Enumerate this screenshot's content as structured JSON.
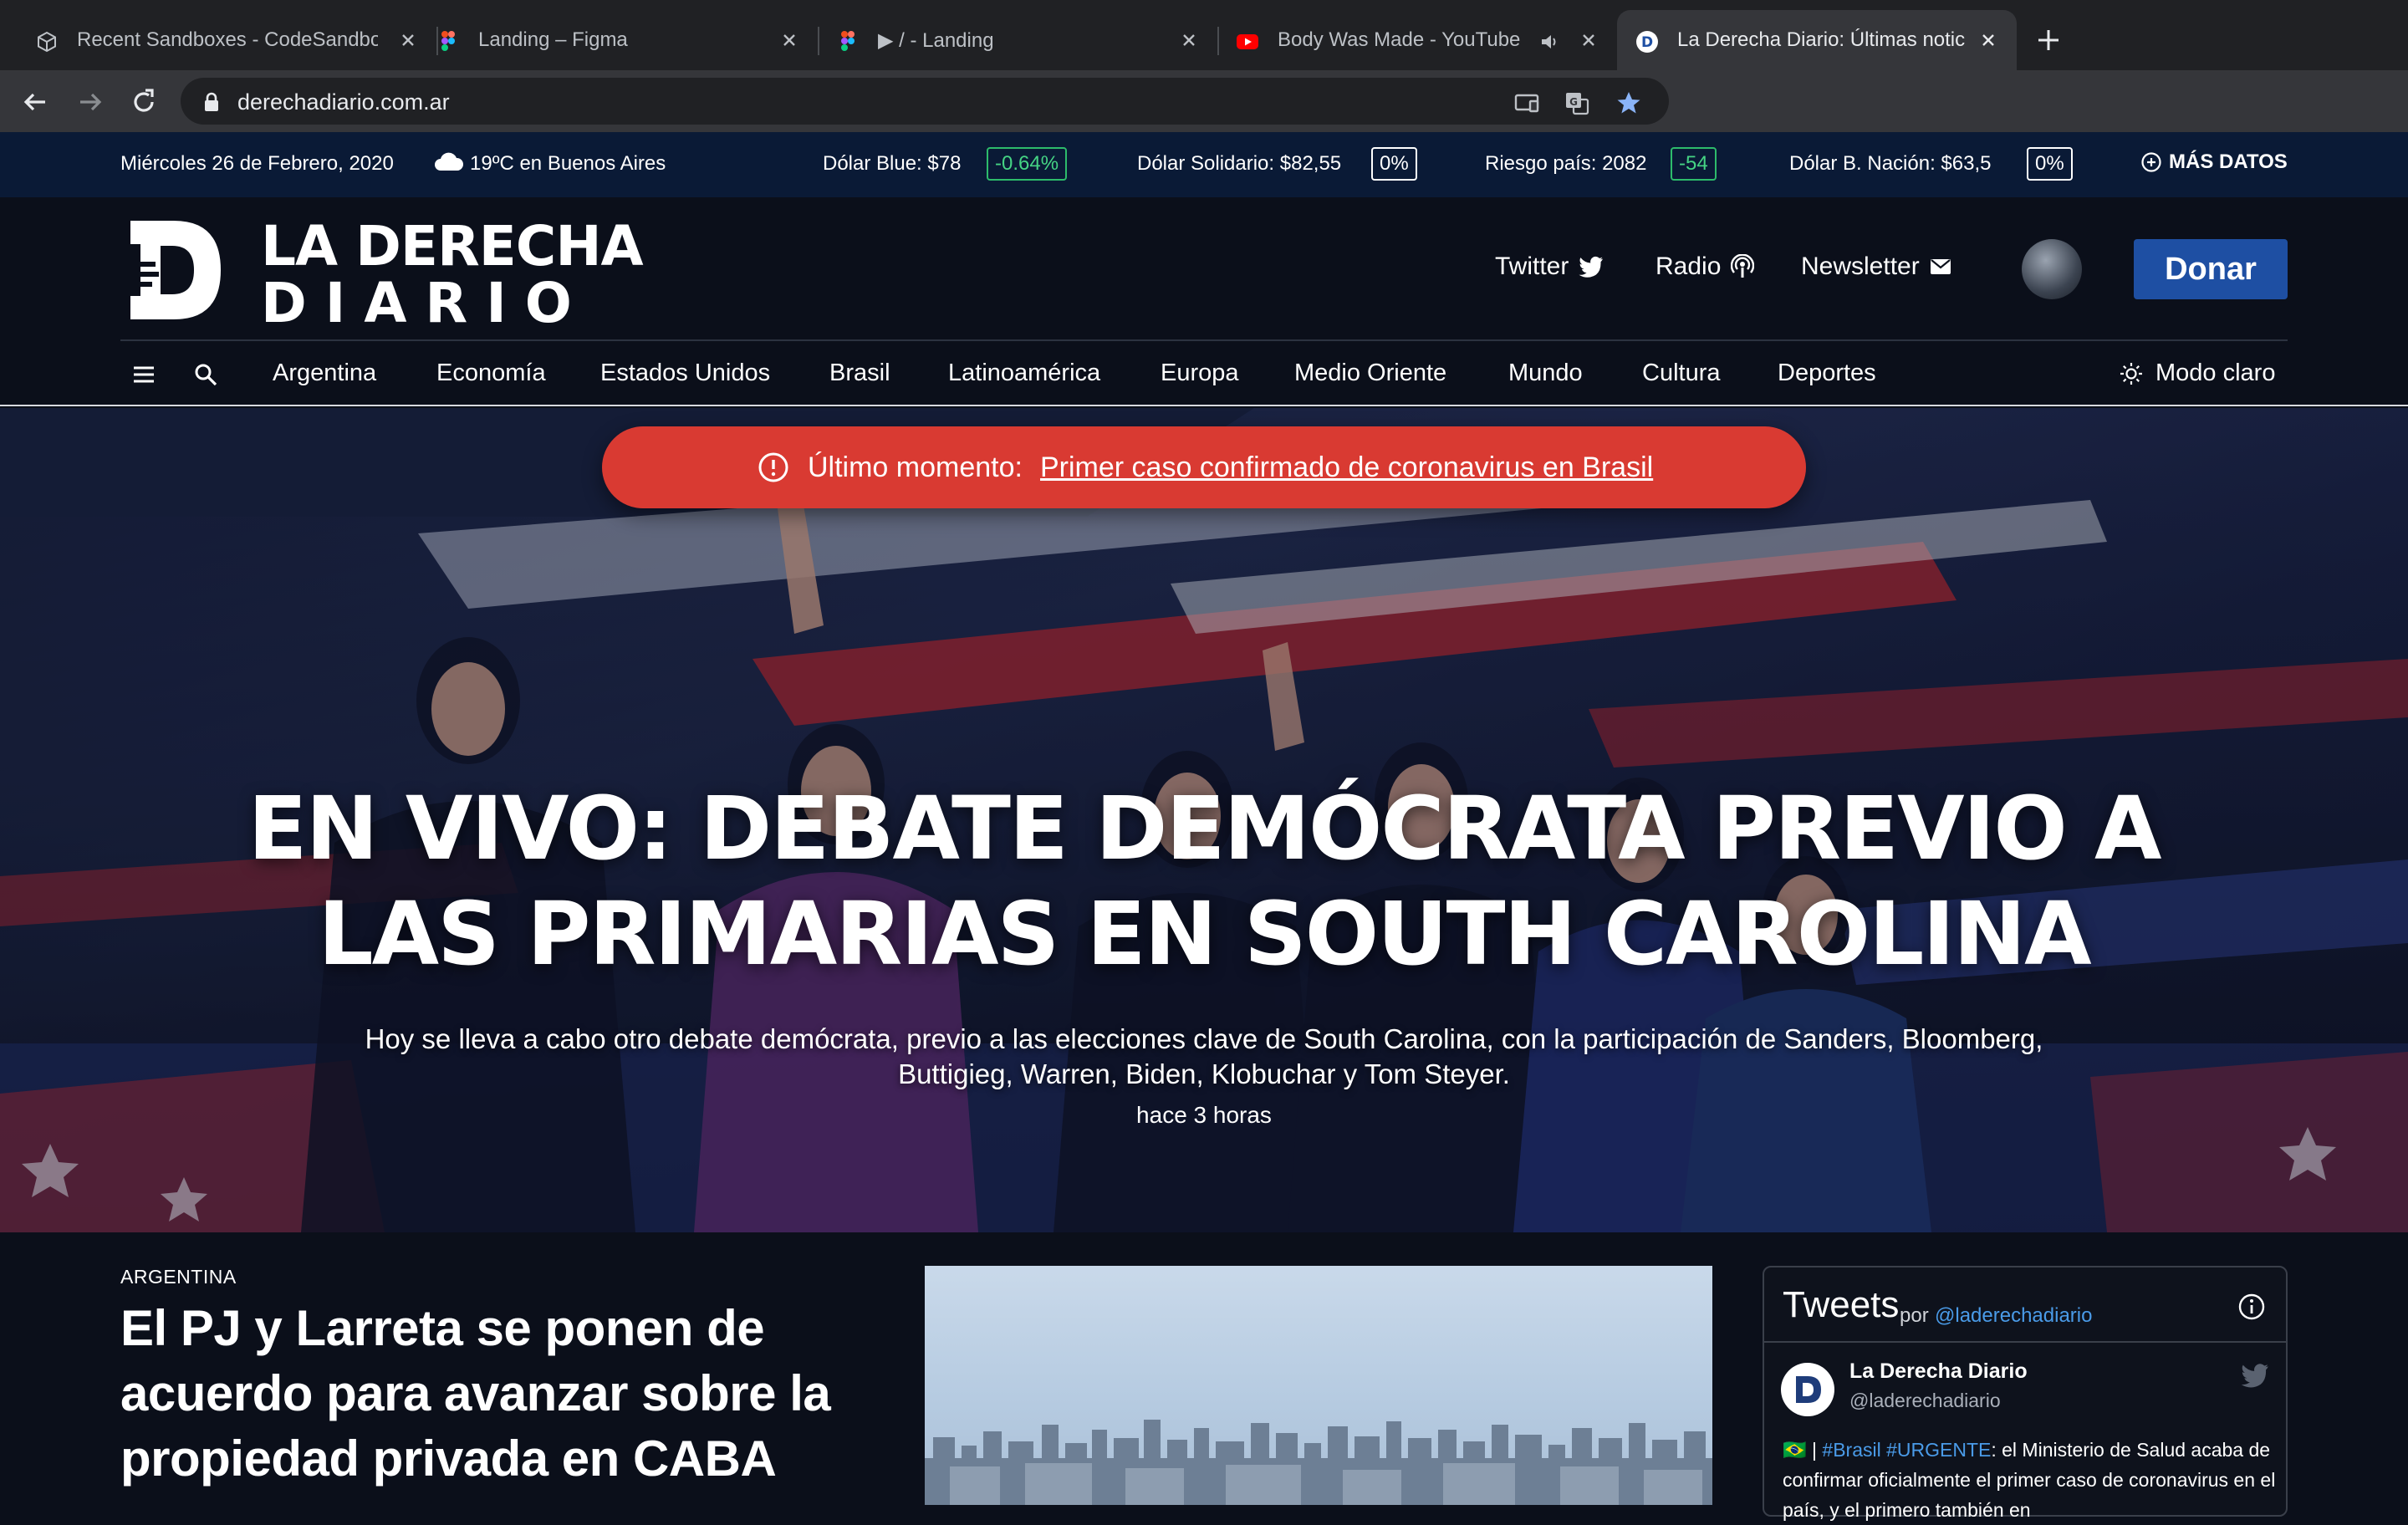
{
  "browser": {
    "tabs": [
      {
        "title": "Recent Sandboxes - CodeSandbox",
        "icon": "codesandbox-icon"
      },
      {
        "title": "Landing – Figma",
        "icon": "figma-icon"
      },
      {
        "title": "▶ / - Landing",
        "icon": "figma-icon"
      },
      {
        "title": "Body Was Made - YouTube",
        "icon": "youtube-icon"
      },
      {
        "title": "La Derecha Diario: Últimas noticias",
        "icon": "derecha-diario-icon"
      }
    ],
    "url": "derechadiario.com.ar"
  },
  "topbar": {
    "date": "Miércoles 26 de Febrero, 2020",
    "weather": "19ºC en Buenos Aires",
    "quotes": [
      {
        "label": "Dólar Blue: $78",
        "delta": "-0.64%"
      },
      {
        "label": "Dólar Solidario: $82,55",
        "delta": "0%"
      },
      {
        "label": "Riesgo país: 2082",
        "delta": "-54"
      },
      {
        "label": "Dólar B. Nación: $63,5",
        "delta": "0%"
      }
    ],
    "more": "MÁS DATOS"
  },
  "header": {
    "logo_line1": "LA DERECHA",
    "logo_line2": "DIARIO",
    "logo_letter": "D",
    "links": {
      "twitter": "Twitter",
      "radio": "Radio",
      "newsletter": "Newsletter"
    },
    "donate": "Donar"
  },
  "nav": {
    "sections": [
      "Argentina",
      "Economía",
      "Estados Unidos",
      "Brasil",
      "Latinoamérica",
      "Europa",
      "Medio Oriente",
      "Mundo",
      "Cultura",
      "Deportes"
    ],
    "theme_toggle": "Modo claro"
  },
  "breaking": {
    "label": "Último momento:",
    "link": "Primer caso confirmado de coronavirus en Brasil"
  },
  "hero": {
    "title": "EN VIVO: DEBATE DEMÓCRATA PREVIO A LAS PRIMARIAS EN SOUTH CAROLINA",
    "description": "Hoy se lleva a cabo otro debate demócrata, previo a las elecciones clave de South Carolina, con la participación de Sanders, Bloomberg, Buttigieg, Warren, Biden, Klobuchar y Tom Steyer.",
    "time": "hace 3 horas"
  },
  "story": {
    "kicker": "ARGENTINA",
    "title": "El PJ y Larreta se ponen de acuerdo para avanzar sobre la propiedad privada en CABA"
  },
  "tweets": {
    "title": "Tweets",
    "by": "por",
    "handle": "@laderechadiario",
    "author": "La Derecha Diario",
    "author_handle": "@laderechadiario",
    "flag": "🇧🇷",
    "sep": "|",
    "hashtag1": "#Brasil",
    "hashtag2": "#URGENTE",
    "text": ": el Ministerio de Salud acaba de confirmar oficialmente el primer caso de coronavirus en el país, y el primero también en"
  },
  "colors": {
    "topbar_bg": "#0a1a36",
    "page_bg": "#0b0f1a",
    "donate_bg": "#1e4fa3",
    "breaking_bg": "#d93a32",
    "positive": "#45d484",
    "link_blue": "#4a9be8"
  }
}
